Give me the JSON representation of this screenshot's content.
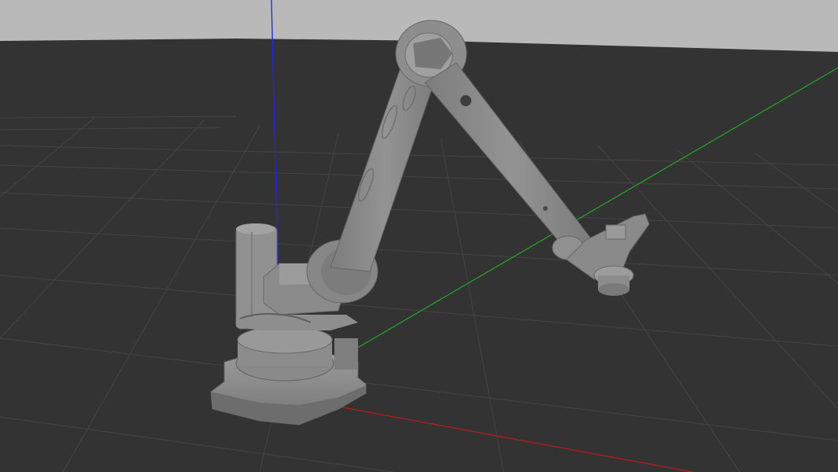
{
  "viewport": {
    "sky_color": "#b9b9b9",
    "ground_color": "#333333",
    "grid_color": "#474747",
    "robot_color": "#878787",
    "robot_dark": "#6f6f6f",
    "robot_light": "#9b9b9b"
  },
  "axes": {
    "x_color": "#b21e1e",
    "y_color": "#25a025",
    "z_color": "#2020ff"
  }
}
